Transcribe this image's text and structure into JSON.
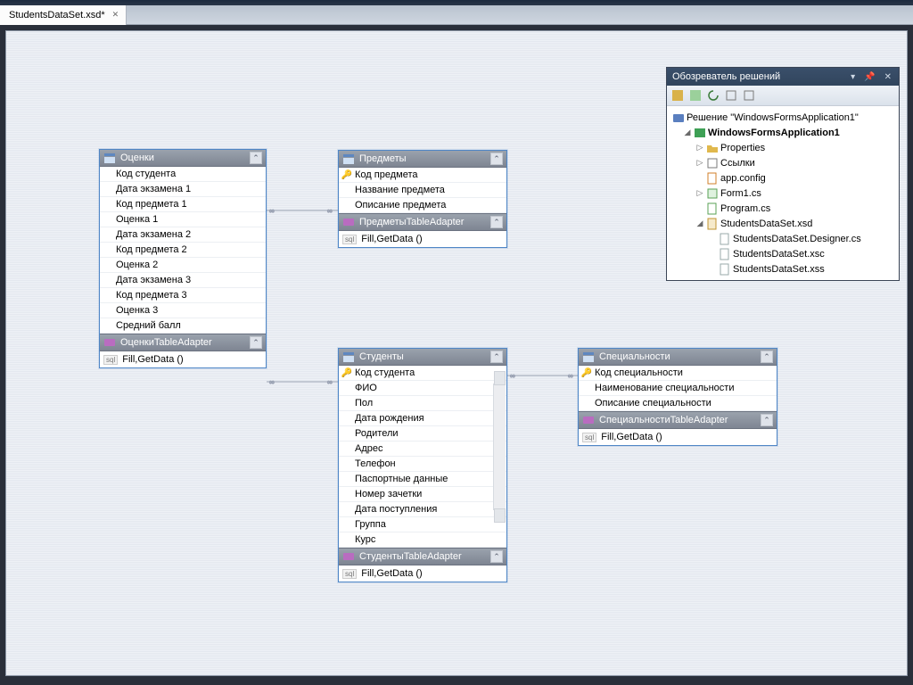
{
  "tab": {
    "name": "StudentsDataSet.xsd*"
  },
  "tables": {
    "grades": {
      "title": "Оценки",
      "columns": [
        "Код студента",
        "Дата экзамена 1",
        "Код предмета 1",
        "Оценка 1",
        "Дата экзамена 2",
        "Код предмета 2",
        "Оценка 2",
        "Дата экзамена 3",
        "Код предмета 3",
        "Оценка 3",
        "Средний балл"
      ],
      "adapter": "ОценкиTableAdapter",
      "method": "Fill,GetData ()"
    },
    "subjects": {
      "title": "Предметы",
      "columns": [
        "Код предмета",
        "Название предмета",
        "Описание предмета"
      ],
      "keys": [
        0
      ],
      "adapter": "ПредметыTableAdapter",
      "method": "Fill,GetData ()"
    },
    "students": {
      "title": "Студенты",
      "columns": [
        "Код студента",
        "ФИО",
        "Пол",
        "Дата рождения",
        "Родители",
        "Адрес",
        "Телефон",
        "Паспортные данные",
        "Номер зачетки",
        "Дата поступления",
        "Группа",
        "Курс"
      ],
      "keys": [
        0
      ],
      "adapter": "СтудентыTableAdapter",
      "method": "Fill,GetData ()"
    },
    "specialities": {
      "title": "Специальности",
      "columns": [
        "Код специальности",
        "Наименование специальности",
        "Описание специальности"
      ],
      "keys": [
        0
      ],
      "adapter": "СпециальностиTableAdapter",
      "method": "Fill,GetData ()"
    }
  },
  "solution": {
    "title": "Обозреватель решений",
    "root": "Решение \"WindowsFormsApplication1\"",
    "project": "WindowsFormsApplication1",
    "items": {
      "properties": "Properties",
      "references": "Ссылки",
      "appconfig": "app.config",
      "form1": "Form1.cs",
      "program": "Program.cs",
      "dataset": "StudentsDataSet.xsd",
      "designer": "StudentsDataSet.Designer.cs",
      "xsc": "StudentsDataSet.xsc",
      "xss": "StudentsDataSet.xss"
    }
  }
}
